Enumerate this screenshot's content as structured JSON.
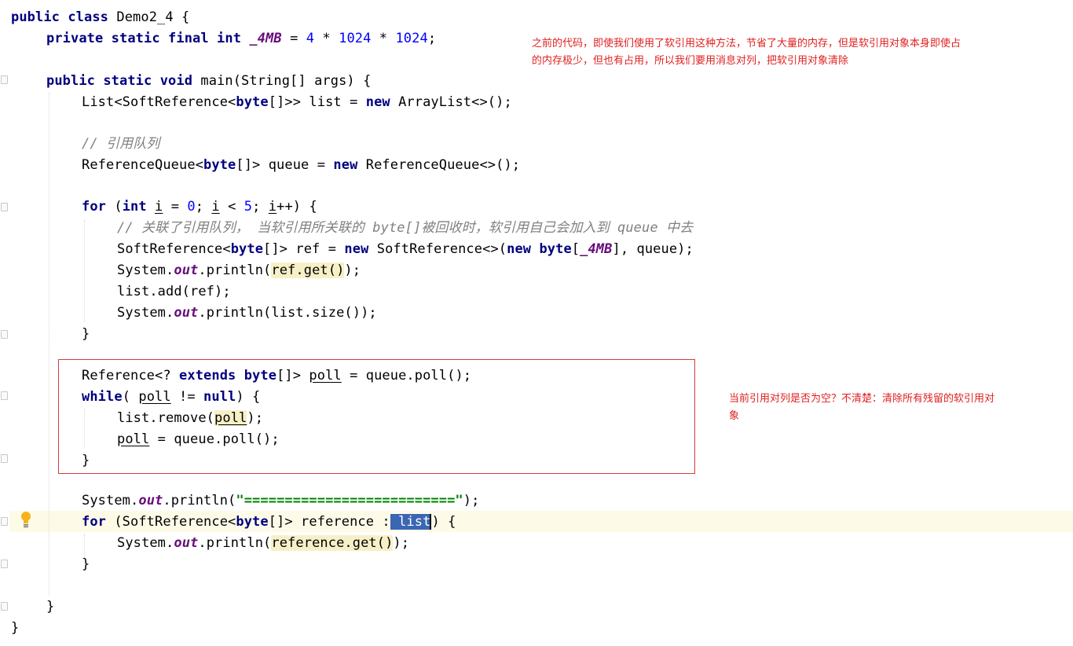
{
  "code": {
    "l1": [
      "public class ",
      "Demo2_4 {"
    ],
    "l2": [
      "private static final ",
      "int ",
      "_4MB",
      " = ",
      "4",
      " * ",
      "1024",
      " * ",
      "1024",
      ";"
    ],
    "l4": [
      "public static void ",
      "main(String[] args) {"
    ],
    "l5": [
      "List<SoftReference<",
      "byte",
      "[]>> list = ",
      "new ",
      "ArrayList<>();"
    ],
    "l7": "// 引用队列",
    "l8": [
      "ReferenceQueue<",
      "byte",
      "[]> queue = ",
      "new ",
      "ReferenceQueue<>();"
    ],
    "l10": [
      "for ",
      "(",
      "int ",
      "i",
      " = ",
      "0",
      "; ",
      "i",
      " < ",
      "5",
      "; ",
      "i",
      "++) {"
    ],
    "l11": "// 关联了引用队列， 当软引用所关联的 byte[]被回收时，软引用自己会加入到 queue 中去",
    "l12": [
      "SoftReference<",
      "byte",
      "[]> ref = ",
      "new ",
      "SoftReference<>(",
      "new ",
      "byte",
      "[",
      "_4MB",
      "], queue);"
    ],
    "l13": [
      "System.",
      "out",
      ".println(",
      "ref.get()",
      ");"
    ],
    "l14": "list.add(ref);",
    "l15": [
      "System.",
      "out",
      ".println(list.size());"
    ],
    "l16": "}",
    "l18": [
      "Reference<? ",
      "extends ",
      "byte",
      "[]> ",
      "poll",
      " = queue.poll();"
    ],
    "l19": [
      "while",
      "( ",
      "poll",
      " != ",
      "null",
      ") {"
    ],
    "l20": [
      "list.remove(",
      "poll",
      ");"
    ],
    "l21": [
      "poll",
      " = queue.poll();"
    ],
    "l22": "}",
    "l24": [
      "System.",
      "out",
      ".println(",
      "\"==========================\"",
      ");"
    ],
    "l25": [
      "for ",
      "(SoftReference<",
      "byte",
      "[]> reference :",
      " list",
      ") {"
    ],
    "l26": [
      "System.",
      "out",
      ".println(",
      "reference.get()",
      ");"
    ],
    "l27": "}",
    "l29": "}",
    "l30": "}"
  },
  "notes": {
    "top_line1": "之前的代码，即使我们使用了软引用这种方法，节省了大量的内存，但是软引用对象本身即使占",
    "top_line2": "的内存极少，但也有占用，所以我们要用消息对列，把软引用对象清除",
    "right_line1": "当前引用对列是否为空？不清楚：清除所有残留的软引用对",
    "right_line2": "象"
  },
  "colors": {
    "keyword": "#000080",
    "number": "#0000ff",
    "field": "#660e7a",
    "comment": "#808080",
    "string": "#008000",
    "annotation": "#e02020",
    "highlight_box": "#d83a3a",
    "selection": "#3b66b3"
  },
  "icons": {
    "gutter_hint": "lightbulb-icon",
    "fold_markers": "fold-marker-icon"
  }
}
